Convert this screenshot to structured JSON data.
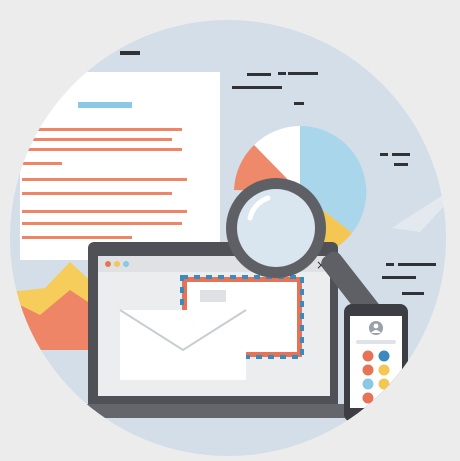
{
  "illustration": {
    "subject": "email-marketing-analytics",
    "colors": {
      "page_bg": "#ececec",
      "circle_bg": "#d3dee8",
      "document_bg": "#ffffff",
      "document_lines": "#ee8567",
      "document_highlight": "#8ac8e6",
      "laptop_body": "#4f5157",
      "laptop_screen": "#ecedef",
      "laptop_titlebar": "#dfe1e4",
      "envelope": "#ffffff",
      "envelope_fold": "#c8cdd3",
      "airmail_red": "#e77356",
      "airmail_blue": "#3a8bbd",
      "magnifier_rim": "#5e6065",
      "magnifier_glass": "#d9e5ef",
      "pie_blue": "#a9d6ea",
      "pie_orange": "#ee8a69",
      "pie_yellow": "#f4c752",
      "pie_white": "#ffffff",
      "area_orange": "#ee8567",
      "area_yellow": "#f6cc5a",
      "area_blue": "#a9d6ea",
      "phone_body": "#3c3e44",
      "phone_screen": "#ffffff",
      "paper_plane": "#ffffff",
      "dash_dark": "#303236"
    },
    "icons": [
      "document-icon",
      "pie-chart-icon",
      "area-chart-icon",
      "laptop-icon",
      "envelope-icon",
      "magnifying-glass-icon",
      "smartphone-icon",
      "paper-plane-icon",
      "user-avatar-icon"
    ],
    "window_controls": {
      "dot_colors": [
        "#e77356",
        "#f4c752",
        "#8ac8e6"
      ],
      "close_glyph": "×"
    },
    "phone_app_colors": [
      "#e77356",
      "#3a8bbd",
      "#e77356",
      "#f4c752",
      "#8ac8e6",
      "#f4c752",
      "#e77356",
      "#f4c752"
    ]
  }
}
